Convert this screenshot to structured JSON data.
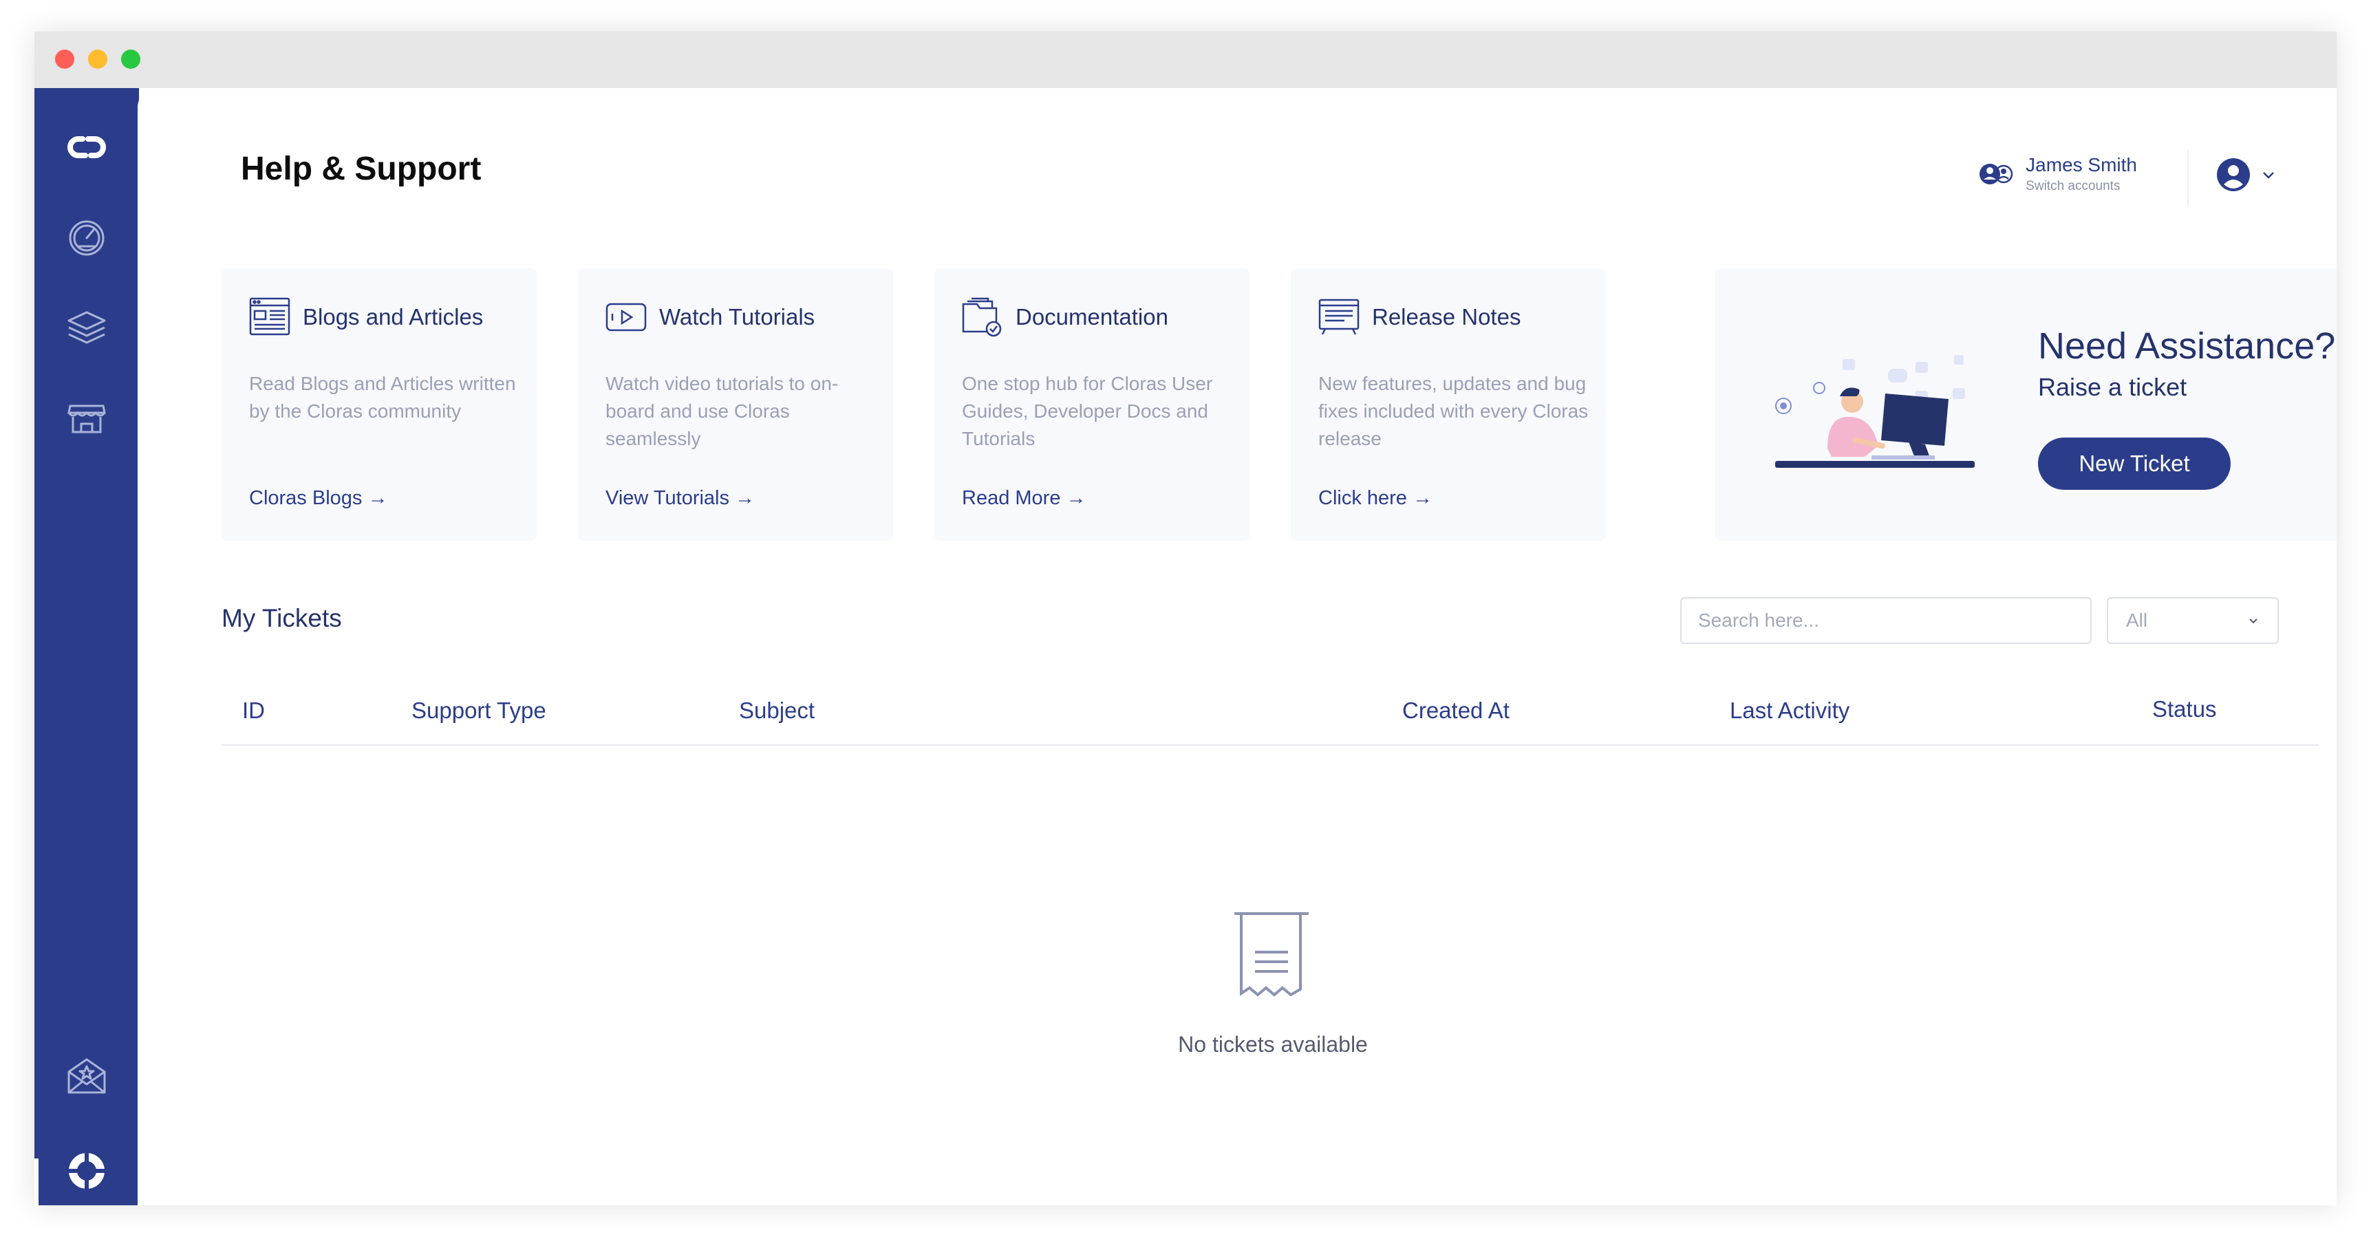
{
  "window": {
    "controls": [
      "close",
      "minimize",
      "maximize"
    ]
  },
  "sidebar": {
    "items": [
      {
        "icon": "cloras-logo-icon"
      },
      {
        "icon": "dashboard-gauge-icon"
      },
      {
        "icon": "layers-icon"
      },
      {
        "icon": "store-icon"
      },
      {
        "icon": "mail-star-icon"
      },
      {
        "icon": "lifebuoy-icon",
        "active": true
      }
    ]
  },
  "header": {
    "title": "Help & Support",
    "account": {
      "name": "James Smith",
      "sub": "Switch accounts"
    }
  },
  "cards": [
    {
      "title": "Blogs and Articles",
      "desc": "Read Blogs and Articles written by the Cloras community",
      "link": "Cloras Blogs →",
      "icon": "blog-icon"
    },
    {
      "title": "Watch Tutorials",
      "desc": "Watch video tutorials to on-board and use Cloras seamlessly",
      "link": "View Tutorials →",
      "icon": "video-icon"
    },
    {
      "title": "Documentation",
      "desc": "One stop hub for Cloras User Guides, Developer Docs and Tutorials",
      "link": "Read More →",
      "icon": "documentation-icon"
    },
    {
      "title": "Release Notes",
      "desc": "New features, updates and bug fixes included with every Cloras release",
      "link": "Click here →",
      "icon": "release-notes-icon"
    }
  ],
  "assist": {
    "title": "Need Assistance?",
    "subtitle": "Raise a ticket",
    "button": "New Ticket",
    "illustration": "support-agent-illustration"
  },
  "tickets": {
    "title": "My Tickets",
    "search_placeholder": "Search here...",
    "filter": "All",
    "columns": [
      "ID",
      "Support Type",
      "Subject",
      "Created At",
      "Last Activity",
      "Status"
    ],
    "rows": [],
    "empty_text": "No tickets available"
  },
  "colors": {
    "brand": "#2b3d8a",
    "card_bg": "#f8f9fd",
    "muted_text": "#9aa0b4"
  }
}
